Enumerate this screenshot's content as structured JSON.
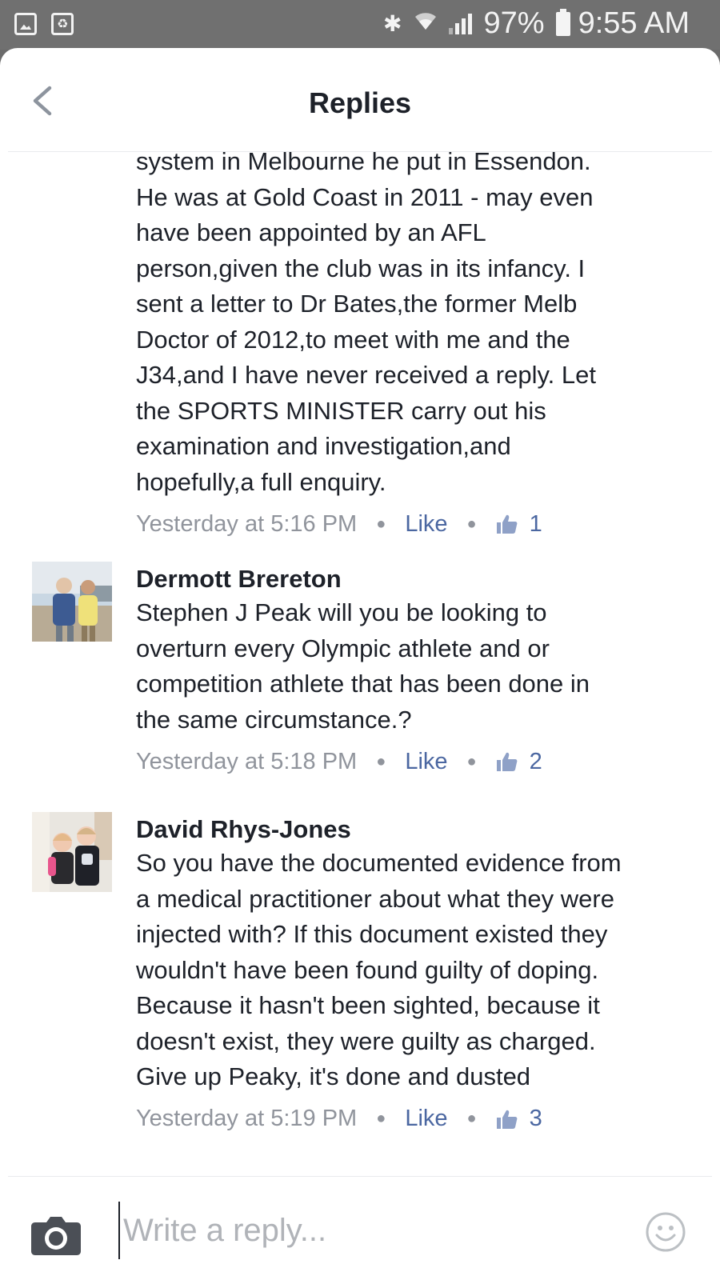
{
  "status_bar": {
    "battery": "97%",
    "time": "9:55 AM",
    "icons": [
      "gallery-icon",
      "recycle-icon",
      "bluetooth-icon",
      "wifi-icon",
      "signal-icon",
      "battery-icon"
    ]
  },
  "header": {
    "title": "Replies",
    "back_icon": "chevron-left-icon"
  },
  "comments": [
    {
      "author": "",
      "text": "system in Melbourne he put in Essendon.\nHe was at Gold Coast in 2011 - may even\nhave been appointed by an AFL\nperson,given the club was in its infancy. I\nsent a letter to Dr Bates,the former Melb\nDoctor of 2012,to meet with me and the\nJ34,and I have never received a reply. Let\nthe SPORTS MINISTER carry out his\nexamination and investigation,and\nhopefully,a full enquiry.",
      "time": "Yesterday at 5:16 PM",
      "like": "Like",
      "likes": "1"
    },
    {
      "author": "Dermott Brereton",
      "text": "Stephen J Peak will you be looking to\noverturn every Olympic athlete and or\ncompetition athlete that has been done in\nthe same circumstance.?",
      "time": "Yesterday at 5:18 PM",
      "like": "Like",
      "likes": "2"
    },
    {
      "author": "David Rhys-Jones",
      "text": "So you have the documented evidence from\na medical practitioner about what they were\ninjected with? If this document existed they\nwouldn't have been found guilty of doping.\nBecause it hasn't been sighted, because it\ndoesn't exist, they were guilty as charged.\nGive up Peaky, it's done and dusted",
      "time": "Yesterday at 5:19 PM",
      "like": "Like",
      "likes": "3"
    }
  ],
  "composer": {
    "placeholder": "Write a reply...",
    "camera_icon": "camera-icon",
    "emoji_icon": "smiley-icon"
  },
  "colors": {
    "link": "#4b67a1",
    "meta": "#90949c",
    "text": "#1d2129",
    "status_bar": "#707070"
  }
}
